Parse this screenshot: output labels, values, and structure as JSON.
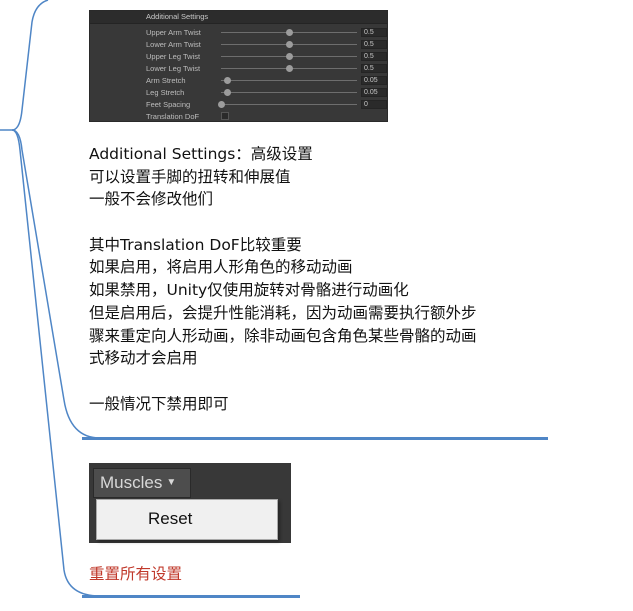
{
  "settings_panel": {
    "title": "Additional Settings",
    "rows": [
      {
        "label": "Upper Arm Twist",
        "value": "0.5",
        "fraction": 0.5
      },
      {
        "label": "Lower Arm Twist",
        "value": "0.5",
        "fraction": 0.5
      },
      {
        "label": "Upper Leg Twist",
        "value": "0.5",
        "fraction": 0.5
      },
      {
        "label": "Lower Leg Twist",
        "value": "0.5",
        "fraction": 0.5
      },
      {
        "label": "Arm Stretch",
        "value": "0.05",
        "fraction": 0.05
      },
      {
        "label": "Leg Stretch",
        "value": "0.05",
        "fraction": 0.05
      },
      {
        "label": "Feet Spacing",
        "value": "0",
        "fraction": 0.0
      }
    ],
    "toggle_label": "Translation DoF",
    "toggle_checked": false
  },
  "notes": {
    "lines": [
      "Additional Settings：高级设置",
      "可以设置手脚的扭转和伸展值",
      "一般不会修改他们",
      "",
      "其中Translation DoF比较重要",
      "如果启用，将启用人形角色的移动动画",
      "如果禁用，Unity仅使用旋转对骨骼进行动画化",
      "但是启用后，会提升性能消耗，因为动画需要执行额外步",
      "骤来重定向人形动画，除非动画包含角色某些骨骼的动画",
      "式移动才会启用",
      "",
      "一般情况下禁用即可"
    ]
  },
  "muscles_dropdown": {
    "button_label": "Muscles",
    "caret_icon": "caret-down-icon",
    "menu_item": "Reset"
  },
  "reset_note": {
    "text": "重置所有设置",
    "color": "#c0392b"
  },
  "colors": {
    "connector": "#4f86c6"
  }
}
